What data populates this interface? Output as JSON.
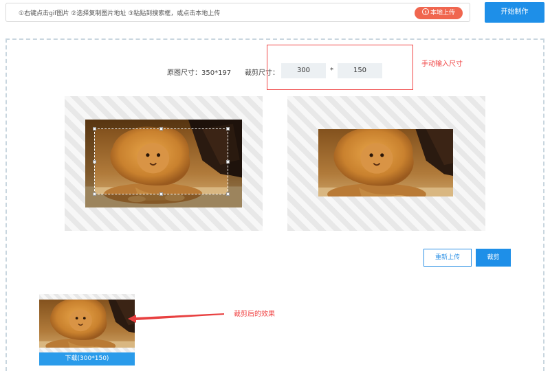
{
  "top_bar": {
    "hint": "①右键点击gif图片 ②选择复制图片地址 ③粘贴到搜索框，或点击本地上传",
    "upload_local_label": "本地上传",
    "upload_icon": "upload-icon",
    "start_label": "开始制作"
  },
  "editor": {
    "original_size": "原图尺寸：350*197",
    "crop_size_label": "裁剪尺寸：",
    "width_value": "300",
    "height_value": "150",
    "times_sign": "*"
  },
  "annotations": {
    "manual_input": "手动输入尺寸",
    "result_effect": "裁剪后的效果"
  },
  "actions": {
    "reupload_label": "重新上传",
    "crop_label": "裁剪",
    "download_label": "下载(300*150)"
  },
  "colors": {
    "accent_blue": "#1e8fe8",
    "upload_red": "#f0664f",
    "annotation_red": "#f04444"
  }
}
